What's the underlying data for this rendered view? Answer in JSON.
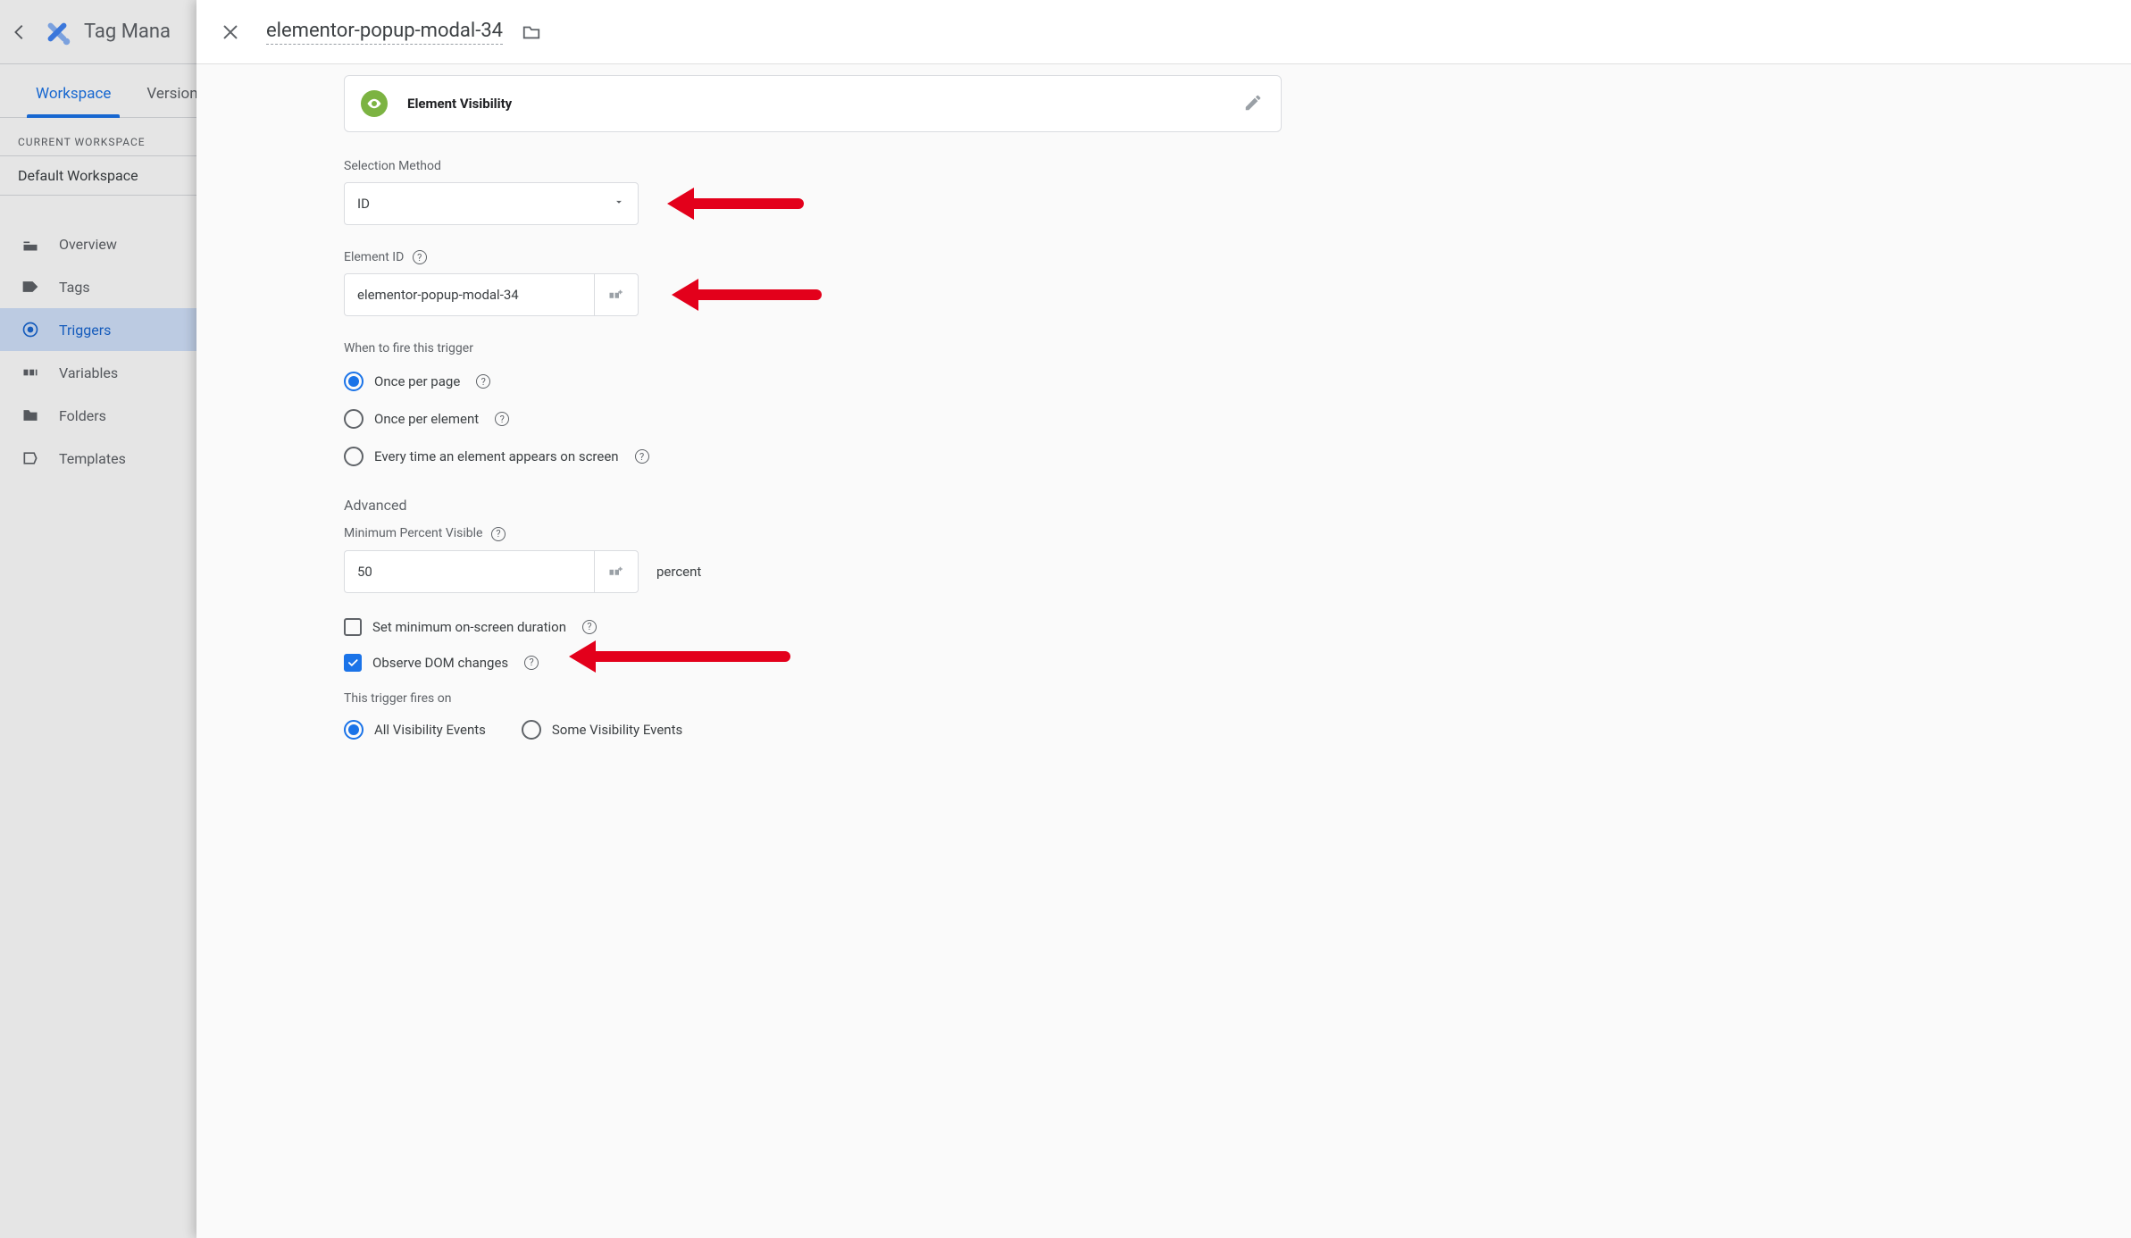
{
  "bg": {
    "app_title": "Tag Mana",
    "tabs": {
      "workspace": "Workspace",
      "versions": "Versions"
    },
    "ws_label": "CURRENT WORKSPACE",
    "ws_name": "Default Workspace",
    "nav": {
      "overview": "Overview",
      "tags": "Tags",
      "triggers": "Triggers",
      "variables": "Variables",
      "folders": "Folders",
      "templates": "Templates"
    }
  },
  "panel": {
    "title": "elementor-popup-modal-34",
    "trigger_type": "Element Visibility",
    "selection_method": {
      "label": "Selection Method",
      "value": "ID"
    },
    "element_id": {
      "label": "Element ID",
      "value": "elementor-popup-modal-34"
    },
    "when_fire": {
      "label": "When to fire this trigger",
      "opt_once_page": "Once per page",
      "opt_once_element": "Once per element",
      "opt_every_time": "Every time an element appears on screen"
    },
    "advanced": {
      "heading": "Advanced",
      "min_percent_label": "Minimum Percent Visible",
      "min_percent_value": "50",
      "percent_suffix": "percent",
      "set_min_duration": "Set minimum on-screen duration",
      "observe_dom": "Observe DOM changes"
    },
    "fires_on": {
      "label": "This trigger fires on",
      "opt_all": "All Visibility Events",
      "opt_some": "Some Visibility Events"
    }
  }
}
